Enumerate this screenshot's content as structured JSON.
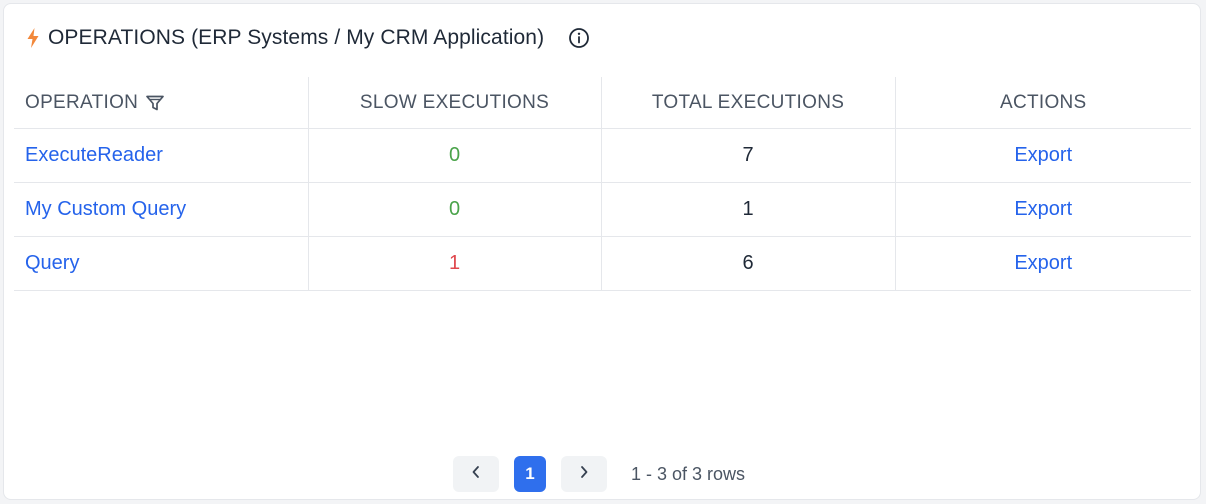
{
  "widget": {
    "title": "OPERATIONS (ERP Systems / My CRM Application)",
    "title_icon": "lightning-bolt-icon",
    "info_icon": "info-circle-icon",
    "accent_color": "#f2883b"
  },
  "table": {
    "columns": {
      "operation": "OPERATION",
      "slow": "SLOW EXECUTIONS",
      "total": "TOTAL EXECUTIONS",
      "actions": "ACTIONS"
    },
    "filter_icon": "filter-funnel-icon",
    "rows": [
      {
        "operation": "ExecuteReader",
        "slow": "0",
        "slow_status": "ok",
        "total": "7",
        "action": "Export"
      },
      {
        "operation": "My Custom Query",
        "slow": "0",
        "slow_status": "ok",
        "total": "1",
        "action": "Export"
      },
      {
        "operation": "Query",
        "slow": "1",
        "slow_status": "warn",
        "total": "6",
        "action": "Export"
      }
    ],
    "status_colors": {
      "ok": "#4aa34a",
      "warn": "#e0484e"
    },
    "link_color": "#2563eb"
  },
  "pagination": {
    "prev_icon": "chevron-left-icon",
    "next_icon": "chevron-right-icon",
    "current_page": "1",
    "summary": "1 - 3 of 3 rows",
    "active_color": "#2f6fed"
  }
}
